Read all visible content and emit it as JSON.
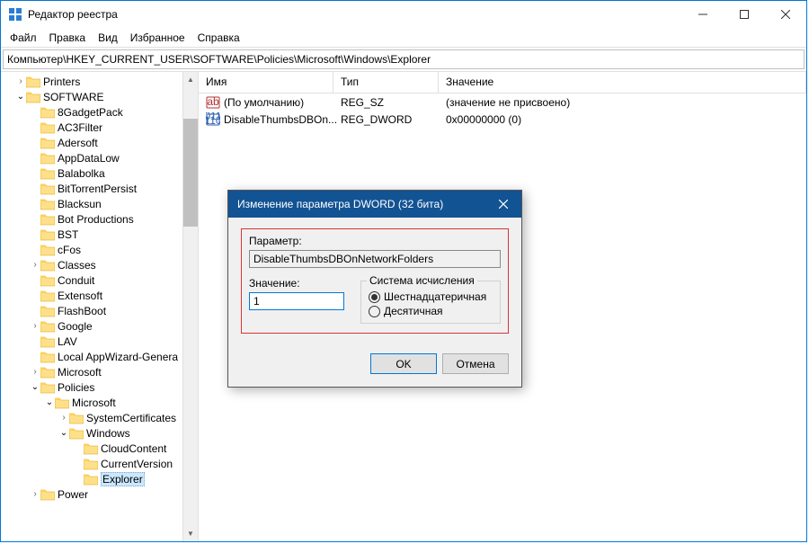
{
  "window": {
    "title": "Редактор реестра"
  },
  "menu": {
    "file": "Файл",
    "edit": "Правка",
    "view": "Вид",
    "favorites": "Избранное",
    "help": "Справка"
  },
  "address": "Компьютер\\HKEY_CURRENT_USER\\SOFTWARE\\Policies\\Microsoft\\Windows\\Explorer",
  "columns": {
    "name": "Имя",
    "type": "Тип",
    "value": "Значение"
  },
  "listRows": [
    {
      "name": "(По умолчанию)",
      "type": "REG_SZ",
      "value": "(значение не присвоено)",
      "icon": "string"
    },
    {
      "name": "DisableThumbsDBOn...",
      "type": "REG_DWORD",
      "value": "0x00000000 (0)",
      "icon": "dword"
    }
  ],
  "tree": [
    {
      "depth": 1,
      "arrow": ">",
      "label": "Printers"
    },
    {
      "depth": 1,
      "arrow": "v",
      "label": "SOFTWARE"
    },
    {
      "depth": 2,
      "arrow": " ",
      "label": "8GadgetPack"
    },
    {
      "depth": 2,
      "arrow": " ",
      "label": "AC3Filter"
    },
    {
      "depth": 2,
      "arrow": " ",
      "label": "Adersoft"
    },
    {
      "depth": 2,
      "arrow": " ",
      "label": "AppDataLow"
    },
    {
      "depth": 2,
      "arrow": " ",
      "label": "Balabolka"
    },
    {
      "depth": 2,
      "arrow": " ",
      "label": "BitTorrentPersist"
    },
    {
      "depth": 2,
      "arrow": " ",
      "label": "Blacksun"
    },
    {
      "depth": 2,
      "arrow": " ",
      "label": "Bot Productions"
    },
    {
      "depth": 2,
      "arrow": " ",
      "label": "BST"
    },
    {
      "depth": 2,
      "arrow": " ",
      "label": "cFos"
    },
    {
      "depth": 2,
      "arrow": ">",
      "label": "Classes"
    },
    {
      "depth": 2,
      "arrow": " ",
      "label": "Conduit"
    },
    {
      "depth": 2,
      "arrow": " ",
      "label": "Extensoft"
    },
    {
      "depth": 2,
      "arrow": " ",
      "label": "FlashBoot"
    },
    {
      "depth": 2,
      "arrow": ">",
      "label": "Google"
    },
    {
      "depth": 2,
      "arrow": " ",
      "label": "LAV"
    },
    {
      "depth": 2,
      "arrow": " ",
      "label": "Local AppWizard-Genera"
    },
    {
      "depth": 2,
      "arrow": ">",
      "label": "Microsoft"
    },
    {
      "depth": 2,
      "arrow": "v",
      "label": "Policies"
    },
    {
      "depth": 3,
      "arrow": "v",
      "label": "Microsoft"
    },
    {
      "depth": 4,
      "arrow": ">",
      "label": "SystemCertificates"
    },
    {
      "depth": 4,
      "arrow": "v",
      "label": "Windows"
    },
    {
      "depth": 5,
      "arrow": " ",
      "label": "CloudContent"
    },
    {
      "depth": 5,
      "arrow": " ",
      "label": "CurrentVersion"
    },
    {
      "depth": 5,
      "arrow": " ",
      "label": "Explorer",
      "selected": true
    },
    {
      "depth": 2,
      "arrow": ">",
      "label": "Power"
    }
  ],
  "dialog": {
    "title": "Изменение параметра DWORD (32 бита)",
    "paramLabel": "Параметр:",
    "paramValue": "DisableThumbsDBOnNetworkFolders",
    "valueLabel": "Значение:",
    "valueInput": "1",
    "radixLabel": "Система исчисления",
    "radixHex": "Шестнадцатеричная",
    "radixDec": "Десятичная",
    "ok": "OK",
    "cancel": "Отмена"
  }
}
